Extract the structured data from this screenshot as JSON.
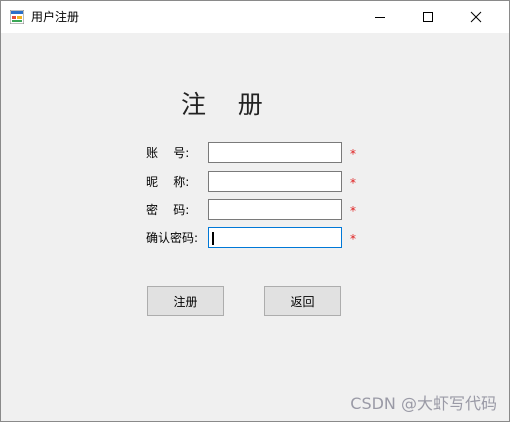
{
  "window": {
    "title": "用户注册"
  },
  "form": {
    "heading": "注    册",
    "fields": [
      {
        "label": "账    号:",
        "value": "",
        "required_mark": "*"
      },
      {
        "label": "昵    称:",
        "value": "",
        "required_mark": "*"
      },
      {
        "label": "密    码:",
        "value": "",
        "required_mark": "*"
      },
      {
        "label": "确认密码:",
        "value": "",
        "required_mark": "*"
      }
    ],
    "register_label": "注册",
    "back_label": "返回"
  },
  "watermark": "CSDN @大虾写代码",
  "colors": {
    "window_bg": "#f0f0f0",
    "titlebar_bg": "#ffffff",
    "required_mark": "#e02020",
    "focus_border": "#0078d7",
    "button_bg": "#e1e1e1"
  },
  "icons": {
    "app": "windows-form-icon",
    "minimize": "minimize-icon",
    "maximize": "maximize-icon",
    "close": "close-icon"
  }
}
